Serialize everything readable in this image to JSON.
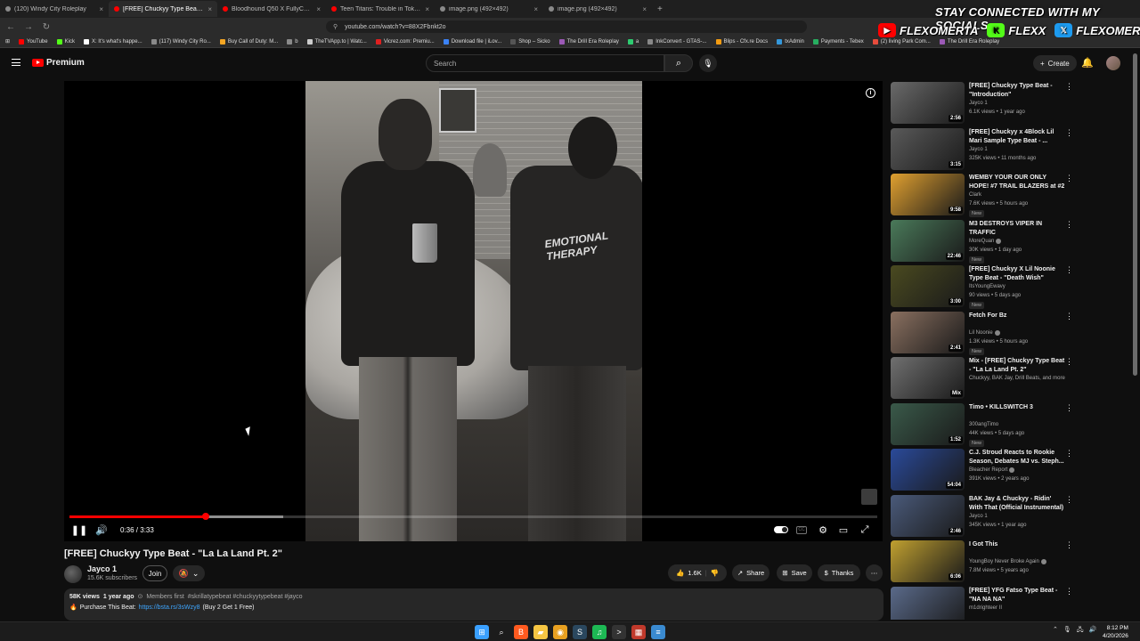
{
  "browser": {
    "tabs": [
      {
        "title": "(120) Windy City Roleplay",
        "color": "#8a8a8a",
        "active": false
      },
      {
        "title": "[FREE] Chuckyy Type Beat - \"L",
        "color": "#ff0000",
        "active": true
      },
      {
        "title": "Bloodhound Q50 X FullyChop Type B",
        "color": "#ff0000",
        "active": false
      },
      {
        "title": "Teen Titans: Trouble in Tokyo - Y",
        "color": "#ff0000",
        "active": false
      },
      {
        "title": "image.png (492×492)",
        "color": "#8a8a8a",
        "active": false
      },
      {
        "title": "image.png (492×492)",
        "color": "#8a8a8a",
        "active": false
      }
    ],
    "new_tab": "+",
    "url": "youtube.com/watch?v=88X2Fbnkt2o",
    "bookmarks": [
      {
        "label": "YouTube",
        "color": "#ff0000"
      },
      {
        "label": "Kick",
        "color": "#53fc18"
      },
      {
        "label": "X: It's what's happe...",
        "color": "#ffffff"
      },
      {
        "label": "(117) Windy City Ro...",
        "color": "#8a8a8a"
      },
      {
        "label": "Buy Call of Duty: M...",
        "color": "#f5a623"
      },
      {
        "label": "b",
        "color": "#8a8a8a"
      },
      {
        "label": "TheTVApp.to | Watc...",
        "color": "#cccccc"
      },
      {
        "label": "Vicrez.com: Premiu...",
        "color": "#e02020"
      },
      {
        "label": "Download file | iLov...",
        "color": "#3b82f6"
      },
      {
        "label": "Shop – Sicko",
        "color": "#555555"
      },
      {
        "label": "The Drill Era Roleplay",
        "color": "#9b59b6"
      },
      {
        "label": "a",
        "color": "#2ecc71"
      },
      {
        "label": "InkConvert - GTAS-...",
        "color": "#888888"
      },
      {
        "label": "Blips - Cfx.re Docs",
        "color": "#f39c12"
      },
      {
        "label": "txAdmin",
        "color": "#3498db"
      },
      {
        "label": "Payments - Tebex",
        "color": "#27ae60"
      },
      {
        "label": "(2) living Park Com...",
        "color": "#e74c3c"
      },
      {
        "label": "The Drill Era Roleplay",
        "color": "#9b59b6"
      }
    ]
  },
  "overlay": {
    "title": "STAY CONNECTED WITH MY SOCIALS",
    "socials": [
      {
        "icon": "youtube-icon",
        "label": "FLEXOMERTA",
        "color": "#ff0000",
        "glyph": "▶"
      },
      {
        "icon": "kick-icon",
        "label": "FLEXX",
        "color": "#53fc18",
        "glyph": "K"
      },
      {
        "icon": "x-icon",
        "label": "FLEXOMERTA",
        "color": "#1d9bf0",
        "glyph": "𝕏"
      }
    ]
  },
  "header": {
    "logo": "Premium",
    "search_placeholder": "Search",
    "create_label": "Create"
  },
  "player": {
    "current_time": "0:36",
    "duration": "3:33",
    "time_sep": " / ",
    "played_fraction": 0.169,
    "buffered_fraction": 0.265,
    "shirt_text": "EMOTIONAL THERAPY"
  },
  "video": {
    "title": "[FREE] Chuckyy Type Beat - \"La La Land Pt. 2\"",
    "channel": "Jayco 1",
    "subscribers": "15.6K subscribers",
    "join_label": "Join",
    "likes": "1.6K",
    "share_label": "Share",
    "save_label": "Save",
    "thanks_label": "Thanks",
    "views": "58K views",
    "age": "1 year ago",
    "members_first": "Members first",
    "tags": "#skrillatypebeat #chuckyytypebeat #jayco",
    "purchase_label": "Purchase This Beat:",
    "purchase_link": "https://bsta.rs/3sWzy8",
    "purchase_note": "(Buy 2 Get 1 Free)"
  },
  "recommendations": [
    {
      "title": "[FREE] Chuckyy Type Beat - \"Introduction\"",
      "channel": "Jayco 1",
      "meta": "6.1K views • 1 year ago",
      "duration": "2:56",
      "new": false,
      "verified": false,
      "thumb": "#6a6a6a"
    },
    {
      "title": "[FREE] Chuckyy x 4Block Lil Mari Sample Type Beat - ...",
      "channel": "Jayco 1",
      "meta": "325K views • 11 months ago",
      "duration": "3:15",
      "new": false,
      "verified": false,
      "thumb": "#5a5a5a"
    },
    {
      "title": "WEMBY YOUR OUR ONLY HOPE! #7 TRAIL BLAZERS at #2 ...",
      "channel": "Clark",
      "meta": "7.6K views • 5 hours ago",
      "duration": "9:58",
      "new": true,
      "verified": false,
      "thumb": "#e0a030"
    },
    {
      "title": "M3 DESTROYS VIPER IN TRAFFIC",
      "channel": "MoreQuan",
      "meta": "30K views • 1 day ago",
      "duration": "22:46",
      "new": true,
      "verified": true,
      "thumb": "#4a7a5a"
    },
    {
      "title": "[FREE] Chuckyy X Lil Noonie Type Beat - \"Death Wish\"",
      "channel": "ItsYoungEwavy",
      "meta": "90 views • 5 days ago",
      "duration": "3:00",
      "new": true,
      "verified": false,
      "thumb": "#4a4a20"
    },
    {
      "title": "Fetch For Bz",
      "channel": "Lil Noonie",
      "meta": "1.3K views • 5 hours ago",
      "duration": "2:41",
      "new": true,
      "verified": true,
      "thumb": "#8a7060"
    },
    {
      "title": "Mix - [FREE] Chuckyy Type Beat - \"La La Land Pt. 2\"",
      "channel": "Chuckyy, BAK Jay, Drill Beats, and more",
      "meta": "",
      "duration": "Mix",
      "new": false,
      "verified": false,
      "thumb": "#707070"
    },
    {
      "title": "Timo • KILLSWITCH 3",
      "channel": "300angTimo",
      "meta": "44K views • 5 days ago",
      "duration": "1:52",
      "new": true,
      "verified": false,
      "thumb": "#3a5a4a"
    },
    {
      "title": "C.J. Stroud Reacts to Rookie Season, Debates MJ vs. Steph...",
      "channel": "Bleacher Report",
      "meta": "391K views • 2 years ago",
      "duration": "54:04",
      "new": false,
      "verified": true,
      "thumb": "#2a4a9a"
    },
    {
      "title": "BAK Jay & Chuckyy - Ridin' With That (Official Instrumental)",
      "channel": "Jayco 1",
      "meta": "345K views • 1 year ago",
      "duration": "2:46",
      "new": false,
      "verified": false,
      "thumb": "#4a5a7a"
    },
    {
      "title": "I Got This",
      "channel": "YoungBoy Never Broke Again",
      "meta": "7.8M views • 5 years ago",
      "duration": "6:06",
      "new": false,
      "verified": true,
      "thumb": "#c0a030"
    },
    {
      "title": "[FREE] YFG Fatso Type Beat - \"NA NA NA\"",
      "channel": "m1drighteer II",
      "meta": "",
      "duration": "",
      "new": false,
      "verified": false,
      "thumb": "#5a6a8a"
    }
  ],
  "taskbar": {
    "apps": [
      {
        "icon": "windows-icon",
        "color": "#3aa0ff",
        "glyph": "⊞"
      },
      {
        "icon": "search-icon",
        "color": "#1c1c1c",
        "glyph": "⌕"
      },
      {
        "icon": "brave-icon",
        "color": "#ff5a1f",
        "glyph": "B"
      },
      {
        "icon": "folder-icon",
        "color": "#f5c542",
        "glyph": "▰"
      },
      {
        "icon": "chrome-icon",
        "color": "#e8a020",
        "glyph": "◉"
      },
      {
        "icon": "steam-icon",
        "color": "#2a475e",
        "glyph": "S"
      },
      {
        "icon": "spotify-icon",
        "color": "#1db954",
        "glyph": "♫"
      },
      {
        "icon": "terminal-icon",
        "color": "#333333",
        "glyph": ">"
      },
      {
        "icon": "app-icon",
        "color": "#c0392b",
        "glyph": "▦"
      },
      {
        "icon": "notepad-icon",
        "color": "#3a8ad0",
        "glyph": "≡"
      }
    ],
    "time": "8:12 PM",
    "date": "4/20/2026"
  }
}
